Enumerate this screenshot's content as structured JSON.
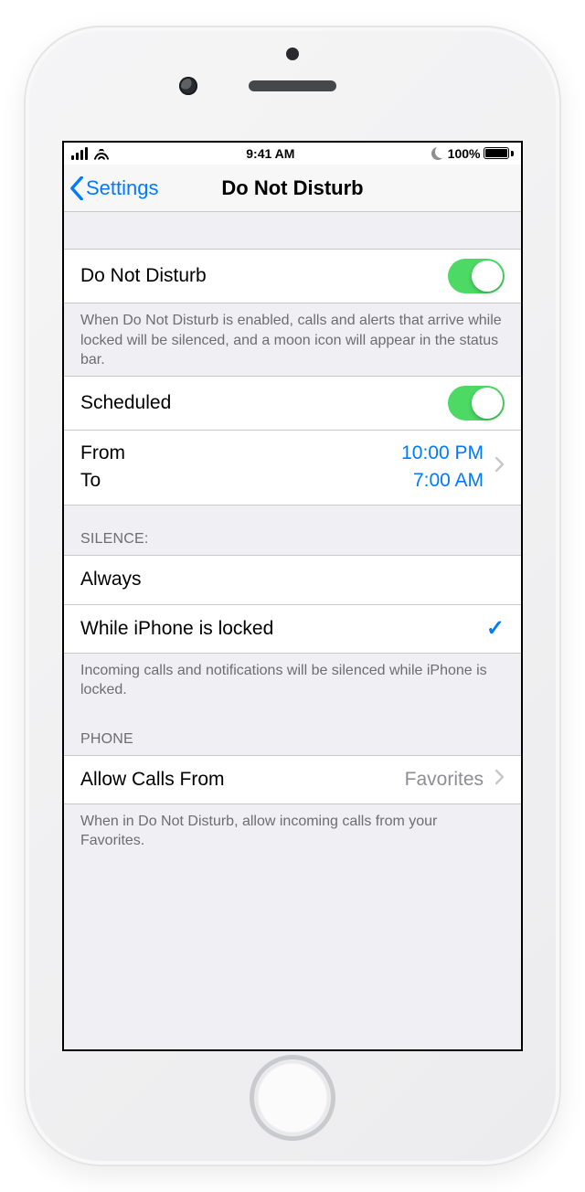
{
  "statusbar": {
    "time": "9:41 AM",
    "battery_pct": "100%"
  },
  "nav": {
    "back_label": "Settings",
    "title": "Do Not Disturb"
  },
  "dnd": {
    "label": "Do Not Disturb",
    "footer": "When Do Not Disturb is enabled, calls and alerts that arrive while locked will be silenced, and a moon icon will appear in the status bar."
  },
  "scheduled": {
    "label": "Scheduled",
    "from_label": "From",
    "from_value": "10:00 PM",
    "to_label": "To",
    "to_value": "7:00 AM"
  },
  "silence": {
    "header": "SILENCE:",
    "always": "Always",
    "locked": "While iPhone is locked",
    "footer": "Incoming calls and notifications will be silenced while iPhone is locked."
  },
  "phone": {
    "header": "PHONE",
    "allow_label": "Allow Calls From",
    "allow_value": "Favorites",
    "footer": "When in Do Not Disturb, allow incoming calls from your Favorites."
  }
}
